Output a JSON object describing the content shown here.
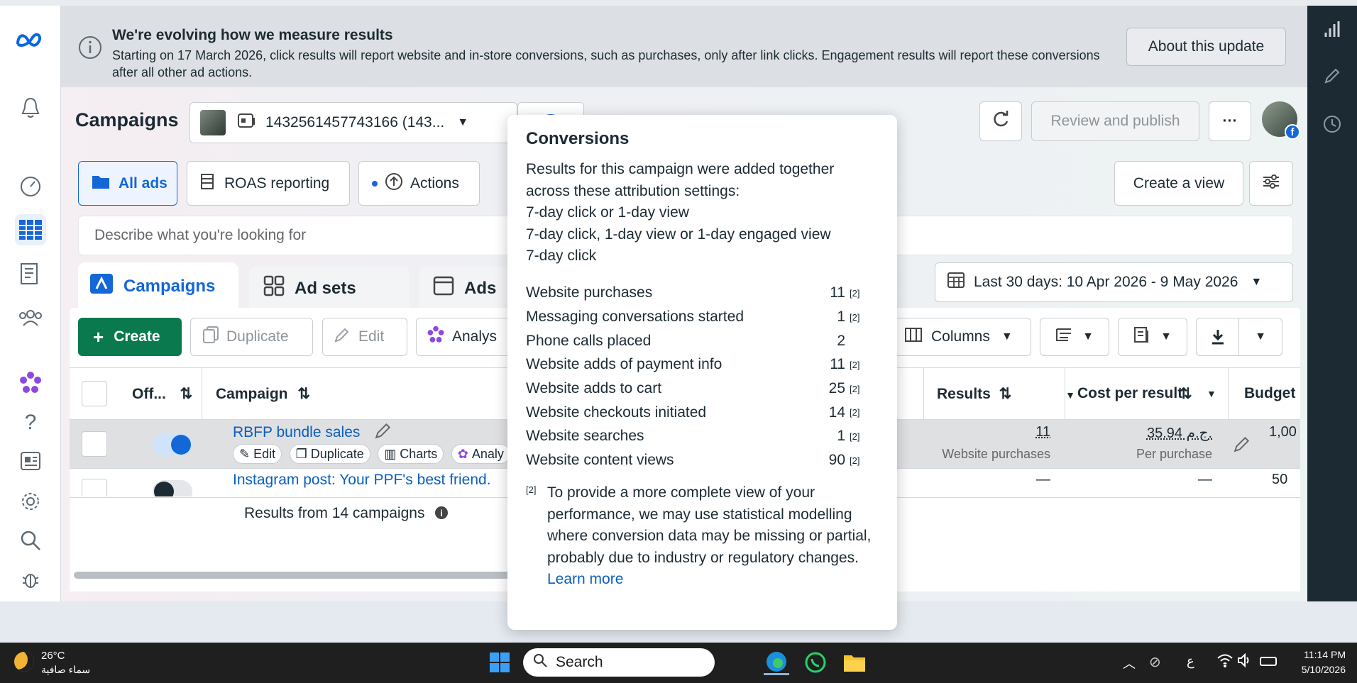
{
  "banner": {
    "title": "We're evolving how we measure results",
    "text": "Starting on 17 March 2026, click results will report website and in-store conversions, such as purchases, only after link clicks. Engagement results will report these conversions after all other ad actions.",
    "button": "About this update"
  },
  "header": {
    "title": "Campaigns",
    "account": "1432561457743166 (143...",
    "review_publish": "Review and publish",
    "more": "···"
  },
  "toolbar": {
    "all_ads": "All ads",
    "roas": "ROAS reporting",
    "actions": "Actions",
    "create_view": "Create a view",
    "search_placeholder": "Describe what you're looking for",
    "date_range": "Last 30 days: 10 Apr 2026 - 9 May 2026"
  },
  "tabs": {
    "campaigns": "Campaigns",
    "ad_sets": "Ad sets",
    "ads": "Ads"
  },
  "actions_bar": {
    "create": "Create",
    "duplicate": "Duplicate",
    "edit": "Edit",
    "analyse": "Analys",
    "columns": "Columns"
  },
  "table": {
    "headers": {
      "off_on": "Off...",
      "campaign": "Campaign",
      "results": "Results",
      "cost_per_result": "Cost per result",
      "budget": "Budget"
    },
    "rows": [
      {
        "name": "RBFP bundle sales",
        "chips": [
          "Edit",
          "Duplicate",
          "Charts",
          "Analy"
        ],
        "results": "11",
        "results_sub": "Website purchases",
        "cost": "35.94 ج.م.",
        "cost_sub": "Per purchase",
        "budget": "1,00",
        "on": true
      },
      {
        "name": "Instagram post: Your PPF's best friend.",
        "results": "—",
        "cost": "—",
        "budget": "50",
        "on": false
      }
    ],
    "footer": "Results from 14 campaigns"
  },
  "popover": {
    "title": "Conversions",
    "desc_lines": [
      "Results for this campaign were added together",
      "across these attribution settings:",
      "7-day click or 1-day view",
      "7-day click, 1-day view or 1-day engaged view",
      "7-day click"
    ],
    "metrics": [
      {
        "label": "Website purchases",
        "value": "11",
        "fn": "[2]"
      },
      {
        "label": "Messaging conversations started",
        "value": "1",
        "fn": "[2]"
      },
      {
        "label": "Phone calls placed",
        "value": "2",
        "fn": ""
      },
      {
        "label": "Website adds of payment info",
        "value": "11",
        "fn": "[2]"
      },
      {
        "label": "Website adds to cart",
        "value": "25",
        "fn": "[2]"
      },
      {
        "label": "Website checkouts initiated",
        "value": "14",
        "fn": "[2]"
      },
      {
        "label": "Website searches",
        "value": "1",
        "fn": "[2]"
      },
      {
        "label": "Website content views",
        "value": "90",
        "fn": "[2]"
      }
    ],
    "footnote_mark": "[2]",
    "footnote": "To provide a more complete view of your performance, we may use statistical modelling where conversion data may be missing or partial, probably due to industry or regulatory changes.",
    "learn_more": "Learn more"
  },
  "taskbar": {
    "weather_temp": "26°C",
    "weather_desc": "سماء صافية",
    "search": "Search",
    "lang": "ع",
    "time": "11:14 PM",
    "date": "5/10/2026"
  },
  "colors": {
    "brand_blue": "#0a5fbe",
    "create_green": "#0a7a4e",
    "dark_rail": "#1c2b33"
  }
}
